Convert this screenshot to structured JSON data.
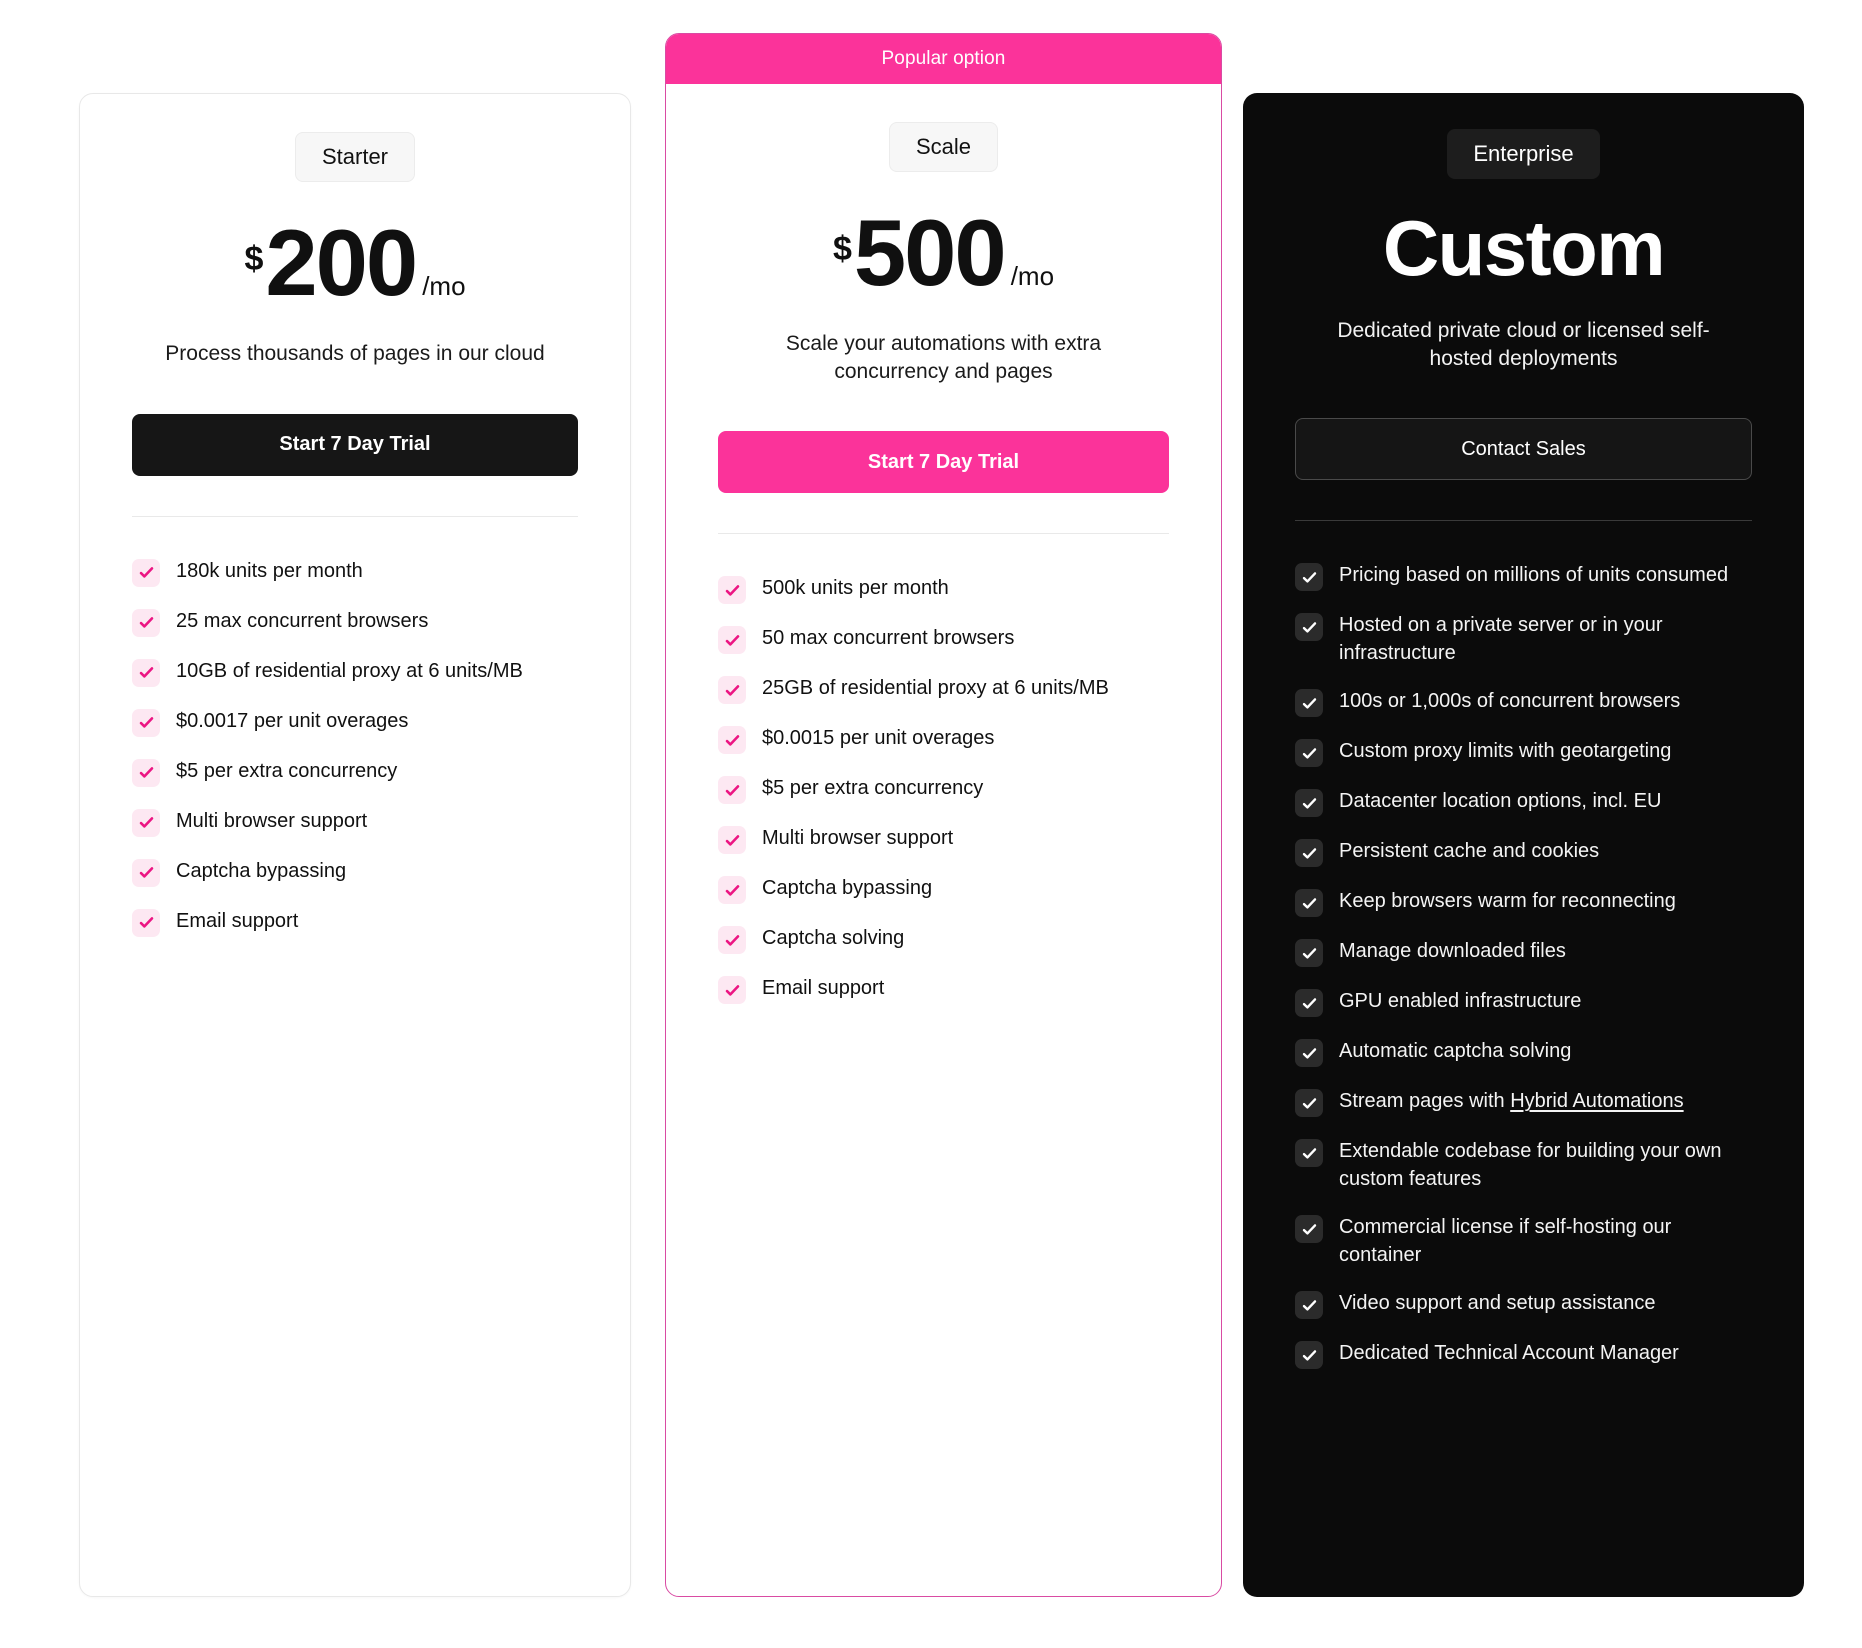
{
  "plans": [
    {
      "id": "starter",
      "badge": "Starter",
      "currency": "$",
      "price": "200",
      "period": "/mo",
      "tagline": "Process thousands of pages in our cloud",
      "cta": "Start 7 Day Trial",
      "features": [
        "180k units per month",
        "25 max concurrent browsers",
        "10GB of residential proxy at 6 units/MB",
        "$0.0017 per unit overages",
        "$5 per extra concurrency",
        "Multi browser support",
        "Captcha bypassing",
        "Email support"
      ]
    },
    {
      "id": "scale",
      "ribbon": "Popular option",
      "badge": "Scale",
      "currency": "$",
      "price": "500",
      "period": "/mo",
      "tagline": "Scale your automations with extra concurrency and pages",
      "cta": "Start 7 Day Trial",
      "features": [
        "500k units per month",
        "50 max concurrent browsers",
        "25GB of residential proxy at 6 units/MB",
        "$0.0015 per unit overages",
        "$5 per extra concurrency",
        "Multi browser support",
        "Captcha bypassing",
        "Captcha solving",
        "Email support"
      ]
    },
    {
      "id": "enterprise",
      "badge": "Enterprise",
      "price": "Custom",
      "tagline": "Dedicated private cloud or licensed self-hosted deployments",
      "cta": "Contact Sales",
      "features": [
        "Pricing based on millions of units consumed",
        "Hosted on a private server or in your infrastructure",
        "100s or 1,000s of concurrent browsers",
        "Custom proxy limits with geotargeting",
        "Datacenter location options, incl. EU",
        "Persistent cache and cookies",
        "Keep browsers warm for reconnecting",
        "Manage downloaded files",
        "GPU enabled infrastructure",
        "Automatic captcha solving",
        "Stream pages with Hybrid Automations",
        "Extendable codebase for building your own custom features",
        "Commercial license if self-hosting our container",
        "Video support and setup assistance",
        "Dedicated Technical Account Manager"
      ],
      "link_text": "Hybrid Automations"
    }
  ],
  "colors": {
    "accent_pink": "#fb339a",
    "check_bg_light": "#fde8f2",
    "check_bg_dark": "#2b2b2b",
    "dark_card": "#0b0b0b",
    "scale_border": "#d94ba3"
  }
}
